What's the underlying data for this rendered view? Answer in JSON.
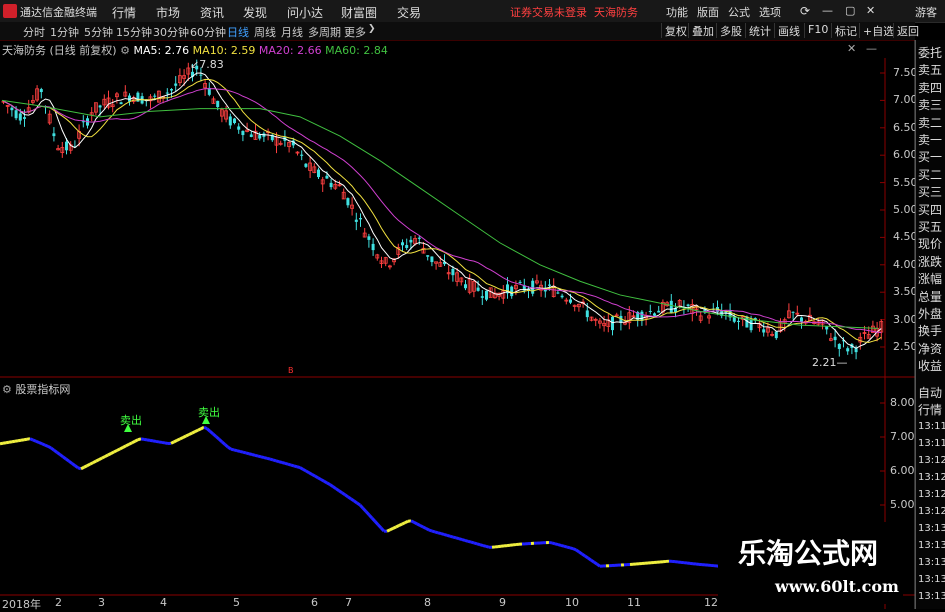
{
  "app": {
    "name": "通达信金融终端"
  },
  "menu": [
    "行情",
    "市场",
    "资讯",
    "发现",
    "问小达",
    "财富圈",
    "交易"
  ],
  "notice": "证券交易未登录",
  "stock_name_top": "天海防务",
  "toolbar_right": [
    "功能",
    "版面",
    "公式",
    "选项"
  ],
  "user": "游客",
  "periods": [
    "分时",
    "1分钟",
    "5分钟",
    "15分钟",
    "30分钟",
    "60分钟",
    "日线",
    "周线",
    "月线",
    "多周期",
    "更多"
  ],
  "active_period": "日线",
  "right_buttons": [
    "复权",
    "叠加",
    "多股",
    "统计",
    "画线",
    "F10",
    "标记",
    "+自选"
  ],
  "back_label": "返回",
  "info": {
    "title": "天海防务 (日线 前复权)",
    "ma5": "MA5: 2.76",
    "ma10": "MA10: 2.59",
    "ma20": "MA20: 2.66",
    "ma60": "MA60: 2.84"
  },
  "colors": {
    "ma5": "#ffffff",
    "ma10": "#f0e040",
    "ma20": "#d040d0",
    "ma60": "#40c040",
    "up": "#ff4040",
    "down": "#40e0e0",
    "blue": "#2020ff",
    "yellow": "#f0f040"
  },
  "price_ticks": [
    "7.50",
    "7.00",
    "6.50",
    "6.00",
    "5.50",
    "5.00",
    "4.50",
    "4.00",
    "3.50",
    "3.00",
    "2.50"
  ],
  "high_label": "7.83",
  "low_label": "2.21",
  "marker": "B",
  "sub": {
    "title": "股票指标网",
    "signals": [
      "卖出",
      "卖出"
    ],
    "ticks": [
      "8.00",
      "7.00",
      "6.00",
      "5.00"
    ]
  },
  "side_labels_top": [
    "委托",
    "卖五",
    "卖四",
    "卖三",
    "卖二",
    "卖一",
    "买一",
    "买二",
    "买三",
    "买四",
    "买五",
    "现价",
    "涨跌",
    "涨幅",
    "总量",
    "外盘",
    "换手",
    "净资",
    "收益"
  ],
  "side_labels_bottom": [
    "自动",
    "行情",
    "13:11",
    "13:11",
    "13:12",
    "13:12",
    "13:12",
    "13:12",
    "13:13",
    "13:13",
    "13:13",
    "13:13",
    "13:13"
  ],
  "x_labels": [
    "2018年",
    "2",
    "3",
    "4",
    "5",
    "6",
    "7",
    "8",
    "9",
    "10",
    "11",
    "12"
  ],
  "watermark": {
    "line1": "乐淘公式网",
    "line2": "www.60lt.com"
  },
  "chart_data": {
    "type": "candlestick",
    "ylim": [
      2.1,
      7.95
    ],
    "x": [
      "2018-01",
      "2018-02",
      "2018-03",
      "2018-04",
      "2018-05",
      "2018-06",
      "2018-07",
      "2018-08",
      "2018-09",
      "2018-10",
      "2018-11",
      "2018-12"
    ],
    "close": [
      7.0,
      6.3,
      6.9,
      7.5,
      6.7,
      6.4,
      5.7,
      4.2,
      3.6,
      3.4,
      3.05,
      2.8
    ],
    "ma60": [
      7.0,
      6.9,
      6.85,
      6.9,
      6.85,
      6.75,
      6.0,
      4.8,
      3.8,
      3.4,
      3.1,
      2.84
    ],
    "sub_line": [
      6.8,
      6.3,
      6.95,
      7.3,
      6.6,
      6.2,
      4.6,
      4.0,
      3.7,
      3.4,
      3.1,
      3.0
    ]
  }
}
